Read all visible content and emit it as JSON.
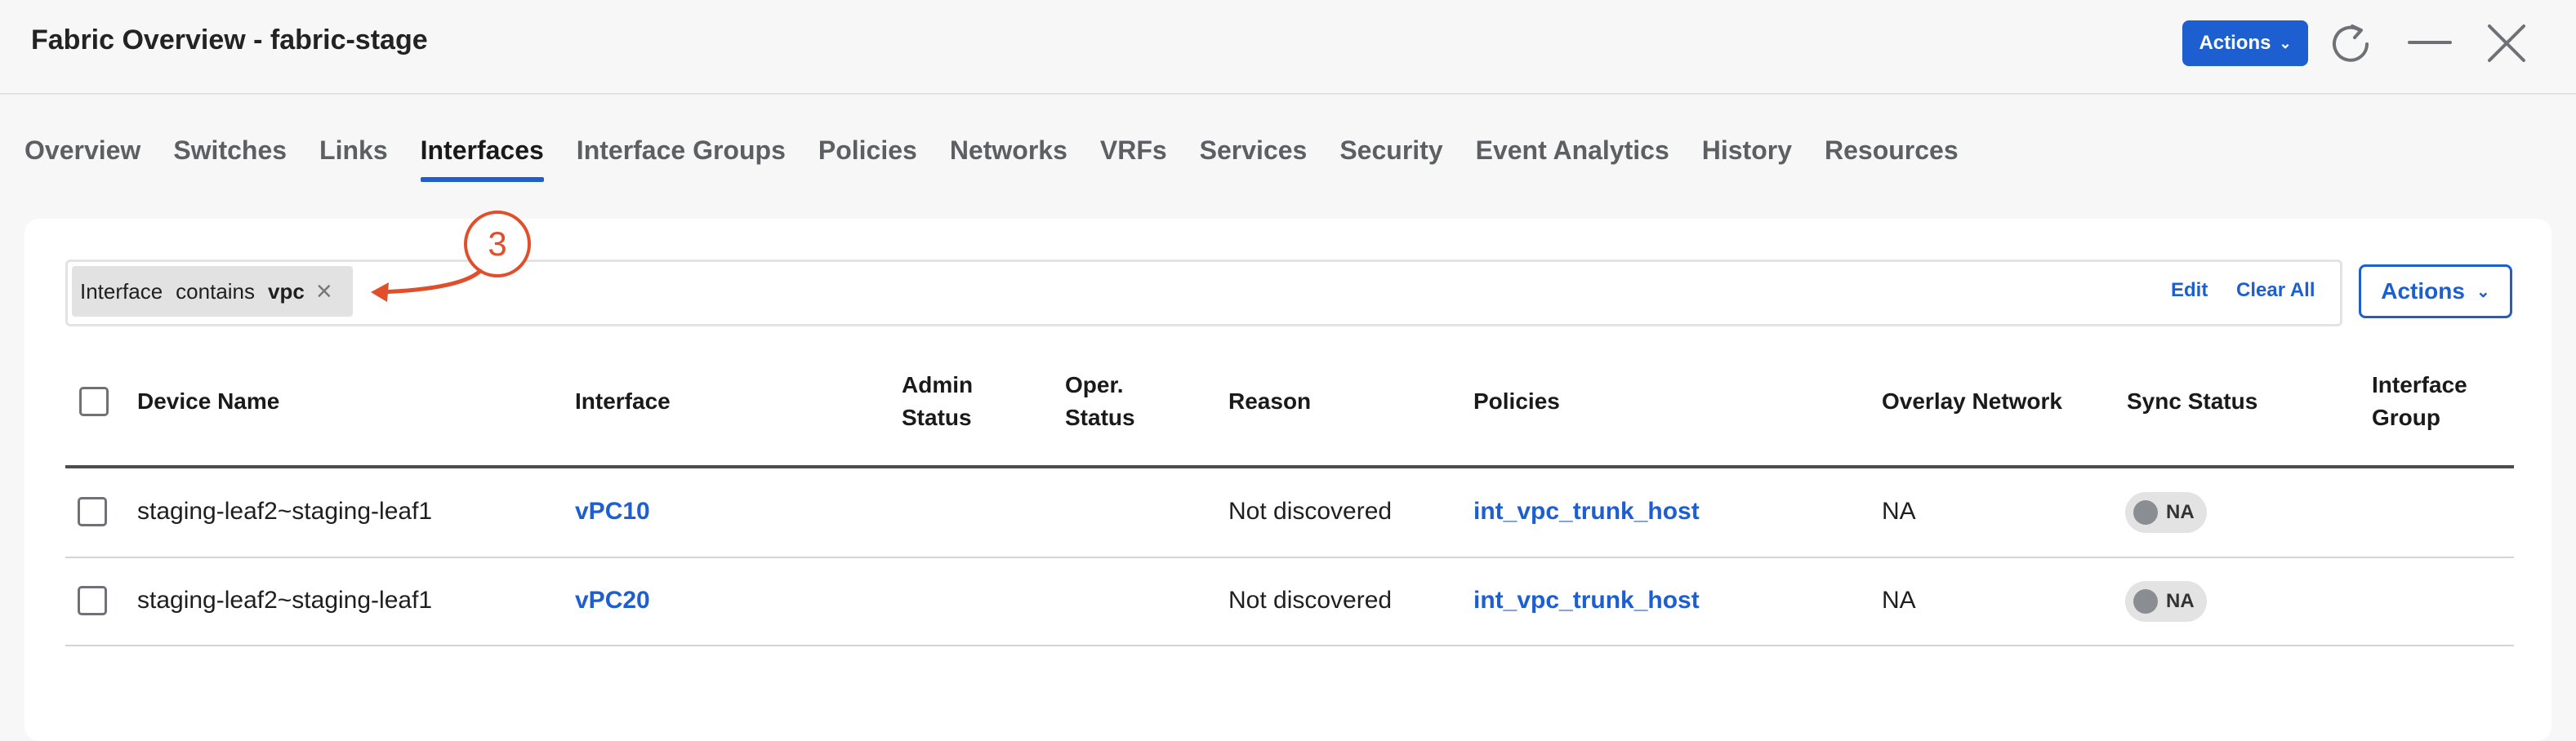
{
  "header": {
    "title": "Fabric Overview - fabric-stage",
    "actions_label": "Actions",
    "icons": [
      "chevron-down-icon",
      "refresh-icon",
      "minimize-icon",
      "close-icon"
    ]
  },
  "tabs": [
    {
      "label": "Overview"
    },
    {
      "label": "Switches"
    },
    {
      "label": "Links"
    },
    {
      "label": "Interfaces",
      "active": true
    },
    {
      "label": "Interface Groups"
    },
    {
      "label": "Policies"
    },
    {
      "label": "Networks"
    },
    {
      "label": "VRFs"
    },
    {
      "label": "Services"
    },
    {
      "label": "Security"
    },
    {
      "label": "Event Analytics"
    },
    {
      "label": "History"
    },
    {
      "label": "Resources"
    }
  ],
  "filter": {
    "chip": {
      "field": "Interface",
      "operator": "contains",
      "value": "vpc"
    },
    "edit_label": "Edit",
    "clear_all_label": "Clear All",
    "actions_label": "Actions"
  },
  "annotation": {
    "number": "3"
  },
  "table": {
    "columns": {
      "device_name": "Device Name",
      "interface": "Interface",
      "admin_status_1": "Admin",
      "admin_status_2": "Status",
      "oper_status_1": "Oper.",
      "oper_status_2": "Status",
      "reason": "Reason",
      "policies": "Policies",
      "overlay_network": "Overlay Network",
      "sync_status": "Sync Status",
      "interface_group_1": "Interface",
      "interface_group_2": "Group"
    },
    "rows": [
      {
        "device": "staging-leaf2~staging-leaf1",
        "interface": "vPC10",
        "admin": "",
        "oper": "",
        "reason": "Not discovered",
        "policy": "int_vpc_trunk_host",
        "overlay": "NA",
        "sync": "NA",
        "group": ""
      },
      {
        "device": "staging-leaf2~staging-leaf1",
        "interface": "vPC20",
        "admin": "",
        "oper": "",
        "reason": "Not discovered",
        "policy": "int_vpc_trunk_host",
        "overlay": "NA",
        "sync": "NA",
        "group": ""
      }
    ]
  },
  "colors": {
    "accent": "#1d5fd1",
    "annotation": "#e04f2a",
    "background": "#f7f7f7"
  }
}
